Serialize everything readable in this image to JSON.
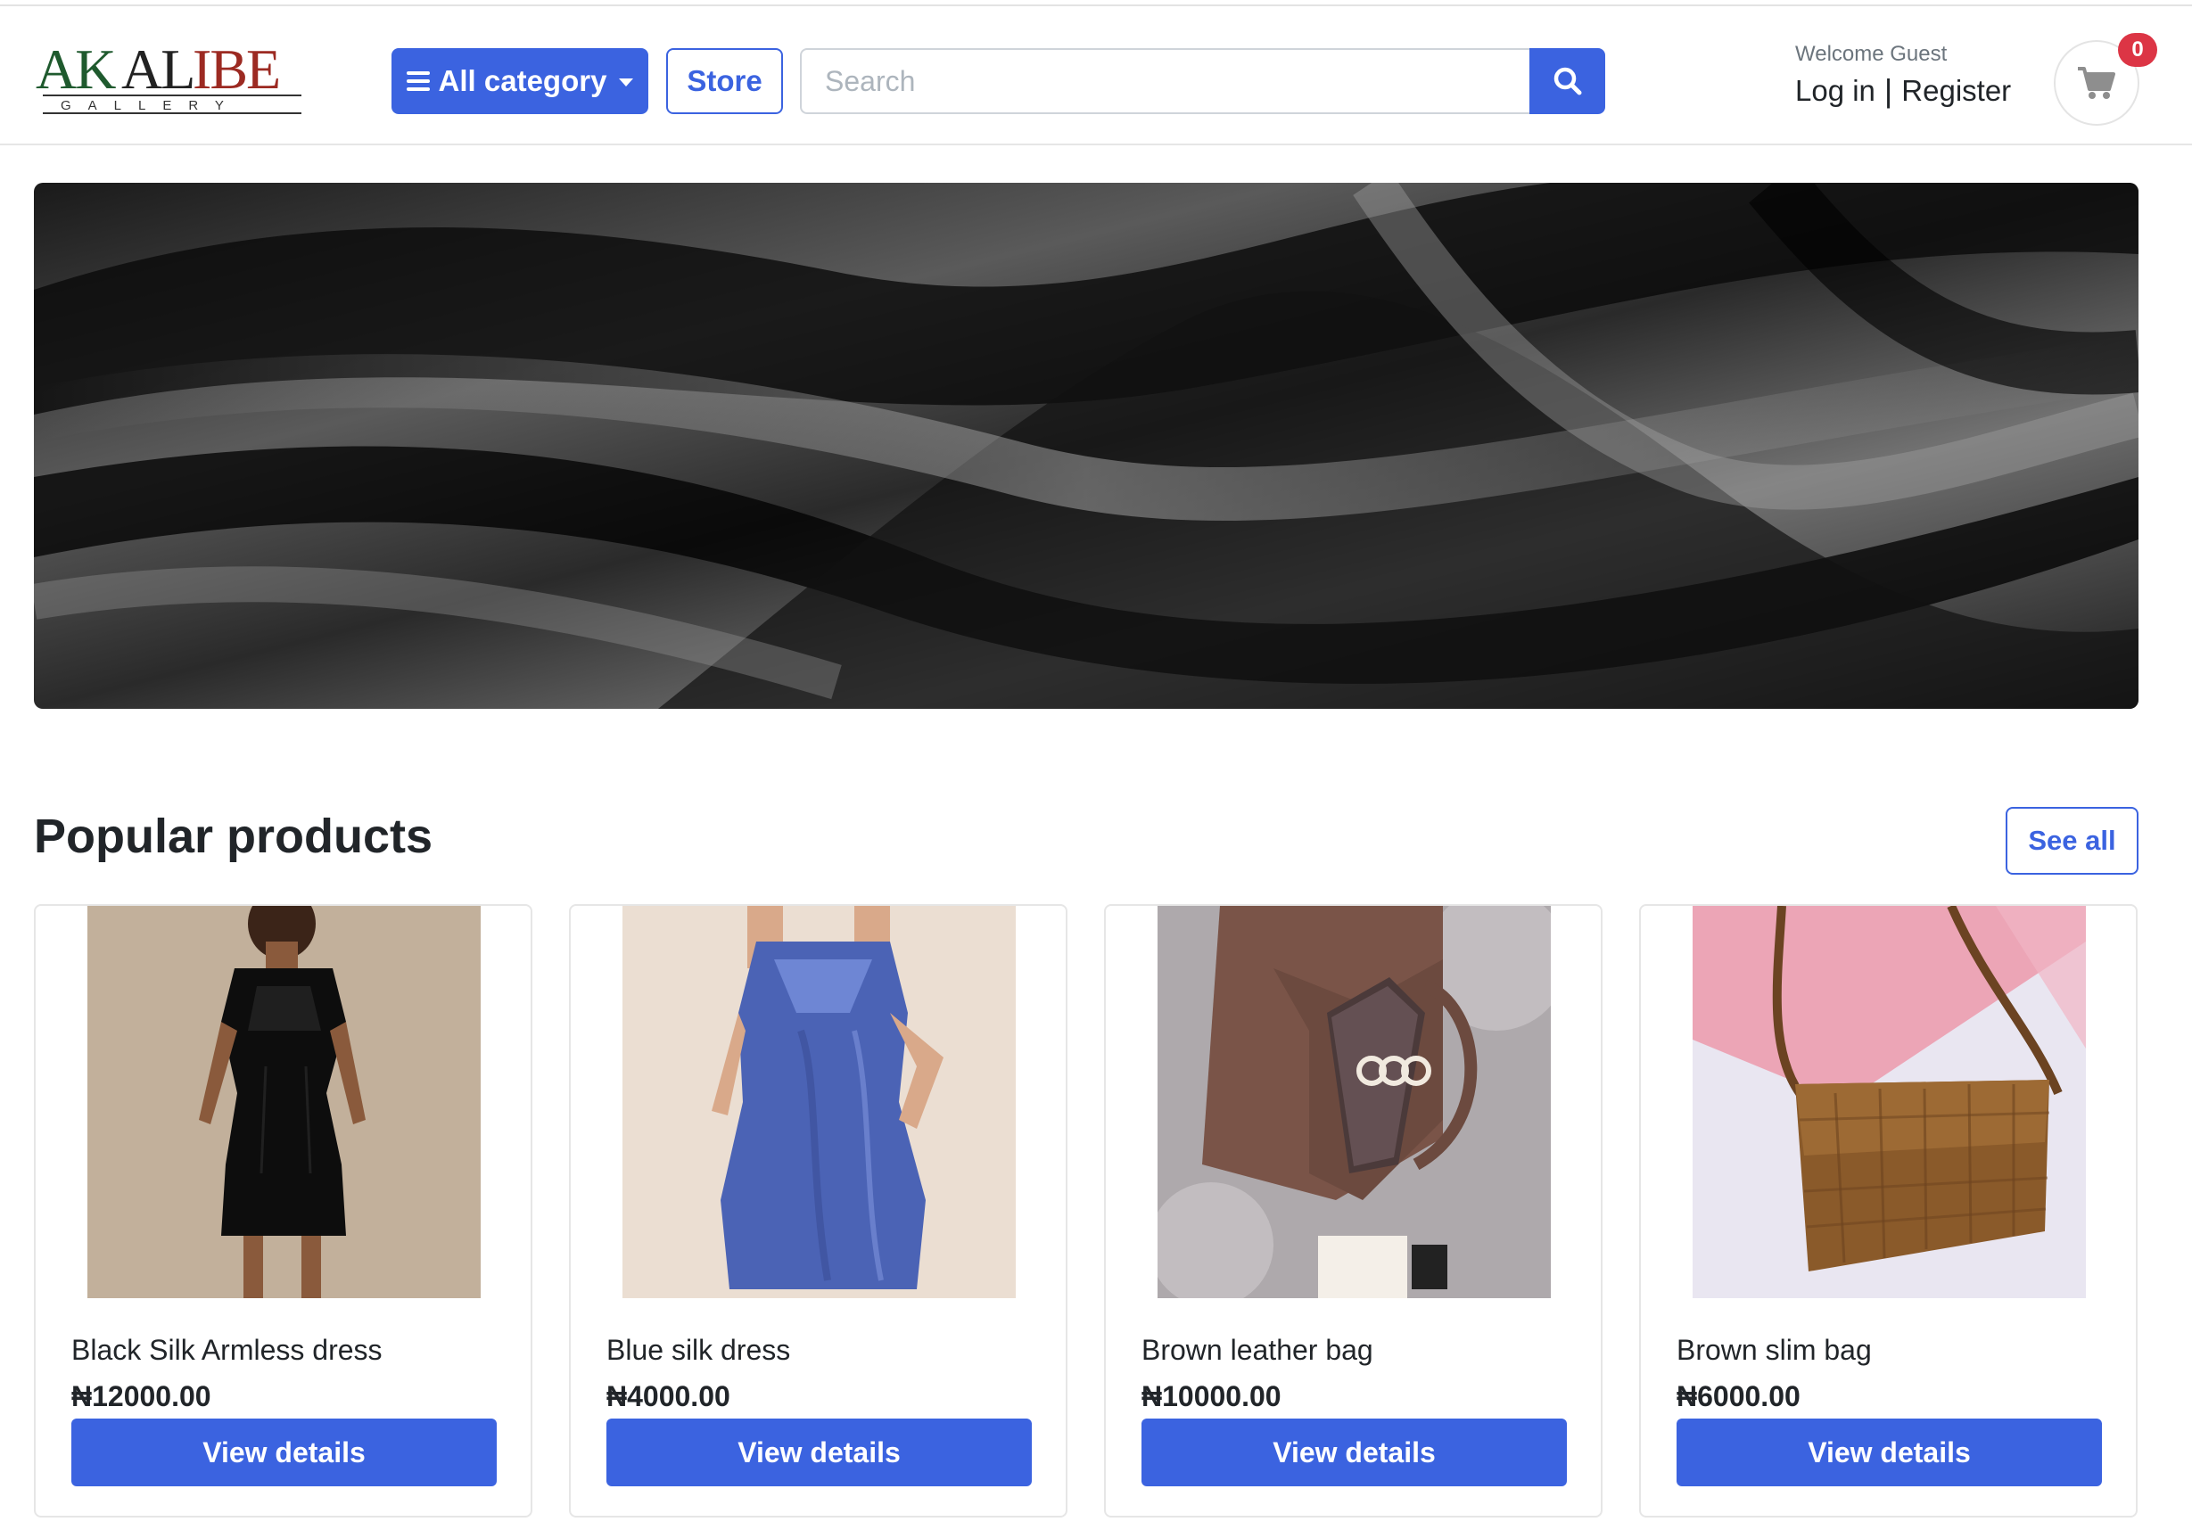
{
  "header": {
    "logo": {
      "main": "AKALIBE",
      "sub": "G A L L E R Y"
    },
    "category_label": "All category",
    "store_label": "Store",
    "search_placeholder": "Search",
    "welcome_text": "Welcome Guest",
    "login_label": "Log in",
    "separator": "|",
    "register_label": "Register",
    "cart_count": "0"
  },
  "hero": {
    "image": "black-silk-fabric-banner"
  },
  "popular": {
    "title": "Popular products",
    "see_all_label": "See all",
    "products": [
      {
        "name": "Black Silk Armless dress",
        "price": "₦12000.00",
        "button": "View details",
        "image": "black-silk-dress"
      },
      {
        "name": "Blue silk dress",
        "price": "₦4000.00",
        "button": "View details",
        "image": "blue-silk-dress"
      },
      {
        "name": "Brown leather bag",
        "price": "₦10000.00",
        "button": "View details",
        "image": "brown-leather-bag"
      },
      {
        "name": "Brown slim bag",
        "price": "₦6000.00",
        "button": "View details",
        "image": "brown-slim-bag"
      }
    ]
  },
  "colors": {
    "primary": "#3b63e0",
    "badge": "#dc3545",
    "text": "#212529",
    "muted": "#6c757d"
  }
}
